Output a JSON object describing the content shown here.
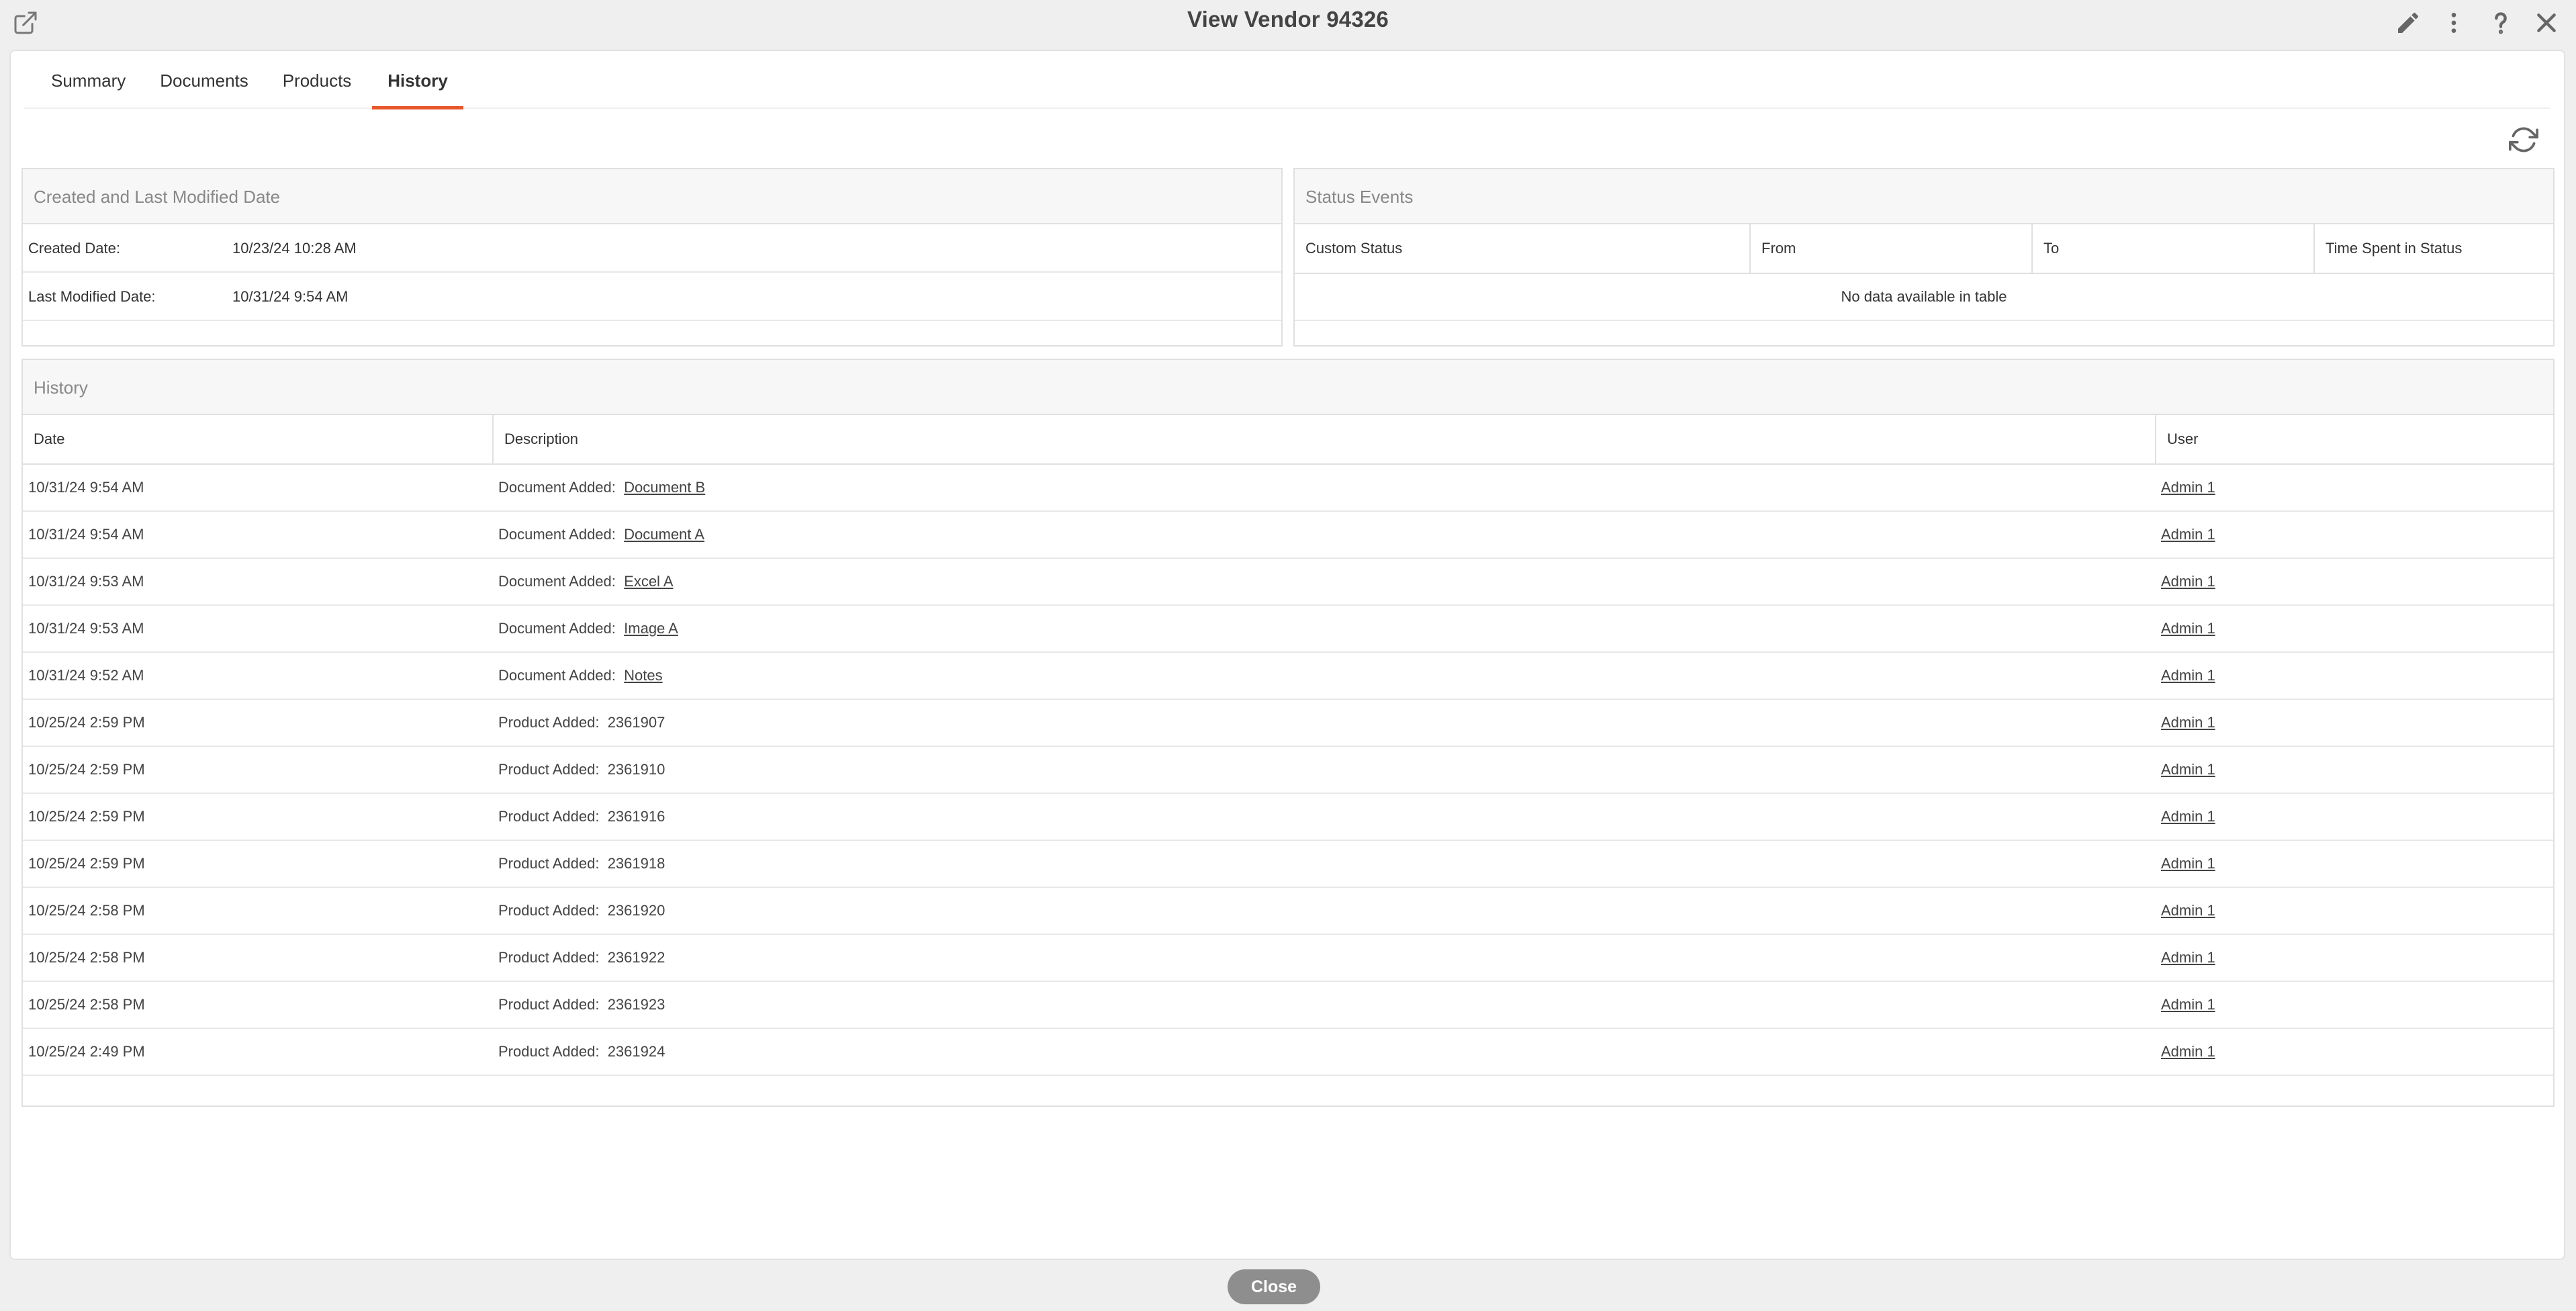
{
  "window": {
    "title": "View Vendor  94326"
  },
  "tabs": [
    {
      "label": "Summary"
    },
    {
      "label": "Documents"
    },
    {
      "label": "Products"
    },
    {
      "label": "History"
    }
  ],
  "active_tab": "History",
  "created_box": {
    "title": "Created and Last Modified Date",
    "rows": [
      {
        "key": "Created Date:",
        "value": "10/23/24 10:28 AM"
      },
      {
        "key": "Last Modified Date:",
        "value": "10/31/24 9:54 AM"
      }
    ]
  },
  "status_box": {
    "title": "Status Events",
    "columns": [
      "Custom Status",
      "From",
      "To",
      "Time Spent in Status"
    ],
    "empty_message": "No data available in table"
  },
  "history_box": {
    "title": "History",
    "columns": [
      "Date",
      "Description",
      "User"
    ],
    "rows": [
      {
        "date": "10/31/24 9:54 AM",
        "prefix": "Document Added:",
        "item": "Document B",
        "item_link": true,
        "user": "Admin 1"
      },
      {
        "date": "10/31/24 9:54 AM",
        "prefix": "Document Added:",
        "item": "Document A",
        "item_link": true,
        "user": "Admin 1"
      },
      {
        "date": "10/31/24 9:53 AM",
        "prefix": "Document Added:",
        "item": "Excel A",
        "item_link": true,
        "user": "Admin 1"
      },
      {
        "date": "10/31/24 9:53 AM",
        "prefix": "Document Added:",
        "item": "Image A",
        "item_link": true,
        "user": "Admin 1"
      },
      {
        "date": "10/31/24 9:52 AM",
        "prefix": "Document Added:",
        "item": "Notes",
        "item_link": true,
        "user": "Admin 1"
      },
      {
        "date": "10/25/24 2:59 PM",
        "prefix": "Product Added:",
        "item": "2361907",
        "item_link": false,
        "user": "Admin 1"
      },
      {
        "date": "10/25/24 2:59 PM",
        "prefix": "Product Added:",
        "item": "2361910",
        "item_link": false,
        "user": "Admin 1"
      },
      {
        "date": "10/25/24 2:59 PM",
        "prefix": "Product Added:",
        "item": "2361916",
        "item_link": false,
        "user": "Admin 1"
      },
      {
        "date": "10/25/24 2:59 PM",
        "prefix": "Product Added:",
        "item": "2361918",
        "item_link": false,
        "user": "Admin 1"
      },
      {
        "date": "10/25/24 2:58 PM",
        "prefix": "Product Added:",
        "item": "2361920",
        "item_link": false,
        "user": "Admin 1"
      },
      {
        "date": "10/25/24 2:58 PM",
        "prefix": "Product Added:",
        "item": "2361922",
        "item_link": false,
        "user": "Admin 1"
      },
      {
        "date": "10/25/24 2:58 PM",
        "prefix": "Product Added:",
        "item": "2361923",
        "item_link": false,
        "user": "Admin 1"
      },
      {
        "date": "10/25/24 2:49 PM",
        "prefix": "Product Added:",
        "item": "2361924",
        "item_link": false,
        "user": "Admin 1"
      }
    ]
  },
  "footer": {
    "close_label": "Close"
  },
  "icons": {
    "popout": "external-link-icon",
    "edit": "pencil-icon",
    "more": "kebab-menu-icon",
    "help": "question-mark-icon",
    "close": "close-icon",
    "refresh": "refresh-icon"
  },
  "colors": {
    "accent": "#e8562a",
    "close_button": "#8e8e8e"
  }
}
